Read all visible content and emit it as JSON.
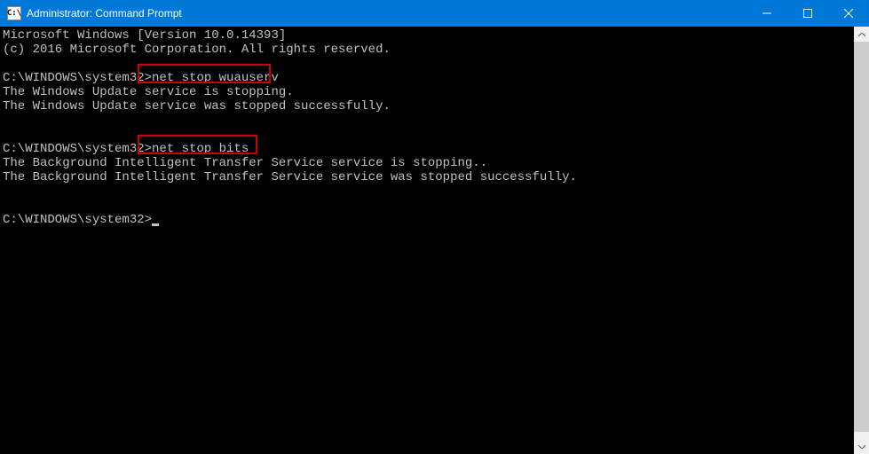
{
  "titlebar": {
    "icon_text": "C:\\",
    "title": "Administrator: Command Prompt",
    "minimize": "—",
    "maximize": "□",
    "close": "✕"
  },
  "terminal": {
    "banner_line1": "Microsoft Windows [Version 10.0.14393]",
    "banner_line2": "(c) 2016 Microsoft Corporation. All rights reserved.",
    "prompt1_path": "C:\\WINDOWS\\system32>",
    "cmd1": "net stop wuauserv",
    "out1_line1": "The Windows Update service is stopping.",
    "out1_line2": "The Windows Update service was stopped successfully.",
    "prompt2_path": "C:\\WINDOWS\\system32>",
    "cmd2": "net stop bits",
    "out2_line1": "The Background Intelligent Transfer Service service is stopping..",
    "out2_line2": "The Background Intelligent Transfer Service service was stopped successfully.",
    "prompt3_path": "C:\\WINDOWS\\system32>"
  },
  "colors": {
    "titlebar_bg": "#0078d7",
    "terminal_bg": "#000000",
    "terminal_fg": "#c0c0c0",
    "highlight_border": "#d00000"
  }
}
